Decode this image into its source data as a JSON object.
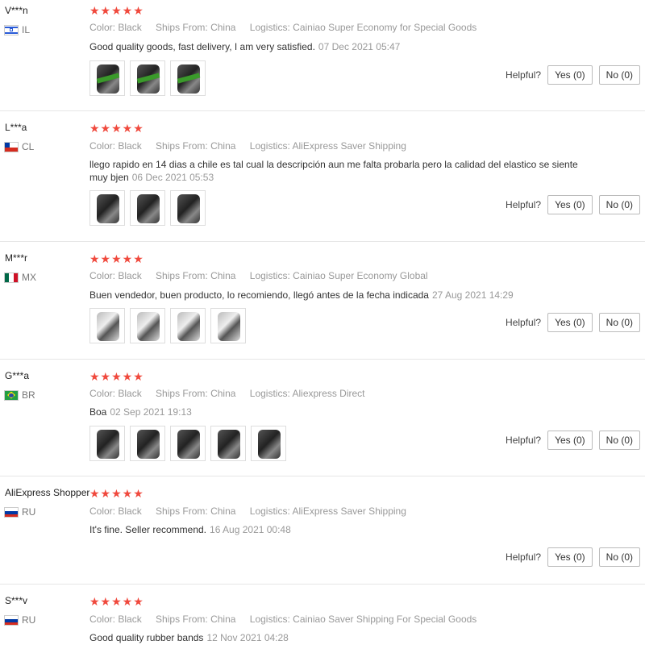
{
  "labels": {
    "color": "Color:",
    "ships_from": "Ships From:",
    "logistics": "Logistics:",
    "helpful": "Helpful?"
  },
  "reviews": [
    {
      "user": "V***n",
      "country": "IL",
      "stars": "★★★★★",
      "color": "Black",
      "ships_from": "China",
      "logistics": "Cainiao Super Economy for Special Goods",
      "text": "Good quality goods, fast delivery, I am very satisfied.",
      "date": "07 Dec 2021 05:47",
      "yes": "Yes (0)",
      "no": "No (0)"
    },
    {
      "user": "L***a",
      "country": "CL",
      "stars": "★★★★★",
      "color": "Black",
      "ships_from": "China",
      "logistics": "AliExpress Saver Shipping",
      "text": "llego rapido en 14 dias a chile es tal cual la descripción aun me falta probarla pero la calidad del elastico se siente muy bjen",
      "date": "06 Dec 2021 05:53",
      "yes": "Yes (0)",
      "no": "No (0)"
    },
    {
      "user": "M***r",
      "country": "MX",
      "stars": "★★★★★",
      "color": "Black",
      "ships_from": "China",
      "logistics": "Cainiao Super Economy Global",
      "text": "Buen vendedor, buen producto, lo recomiendo, llegó antes de la fecha indicada",
      "date": "27 Aug 2021 14:29",
      "yes": "Yes (0)",
      "no": "No (0)"
    },
    {
      "user": "G***a",
      "country": "BR",
      "stars": "★★★★★",
      "color": "Black",
      "ships_from": "China",
      "logistics": "Aliexpress Direct",
      "text": "Boa",
      "date": "02 Sep 2021 19:13",
      "yes": "Yes (0)",
      "no": "No (0)"
    },
    {
      "user": "AliExpress Shopper",
      "country": "RU",
      "stars": "★★★★★",
      "color": "Black",
      "ships_from": "China",
      "logistics": "AliExpress Saver Shipping",
      "text": "It's fine. Seller recommend.",
      "date": "16 Aug 2021 00:48",
      "yes": "Yes (0)",
      "no": "No (0)"
    },
    {
      "user": "S***v",
      "country": "RU",
      "stars": "★★★★★",
      "color": "Black",
      "ships_from": "China",
      "logistics": "Cainiao Saver Shipping For Special Goods",
      "text": "Good quality rubber bands",
      "date": "12 Nov 2021 04:28"
    }
  ]
}
